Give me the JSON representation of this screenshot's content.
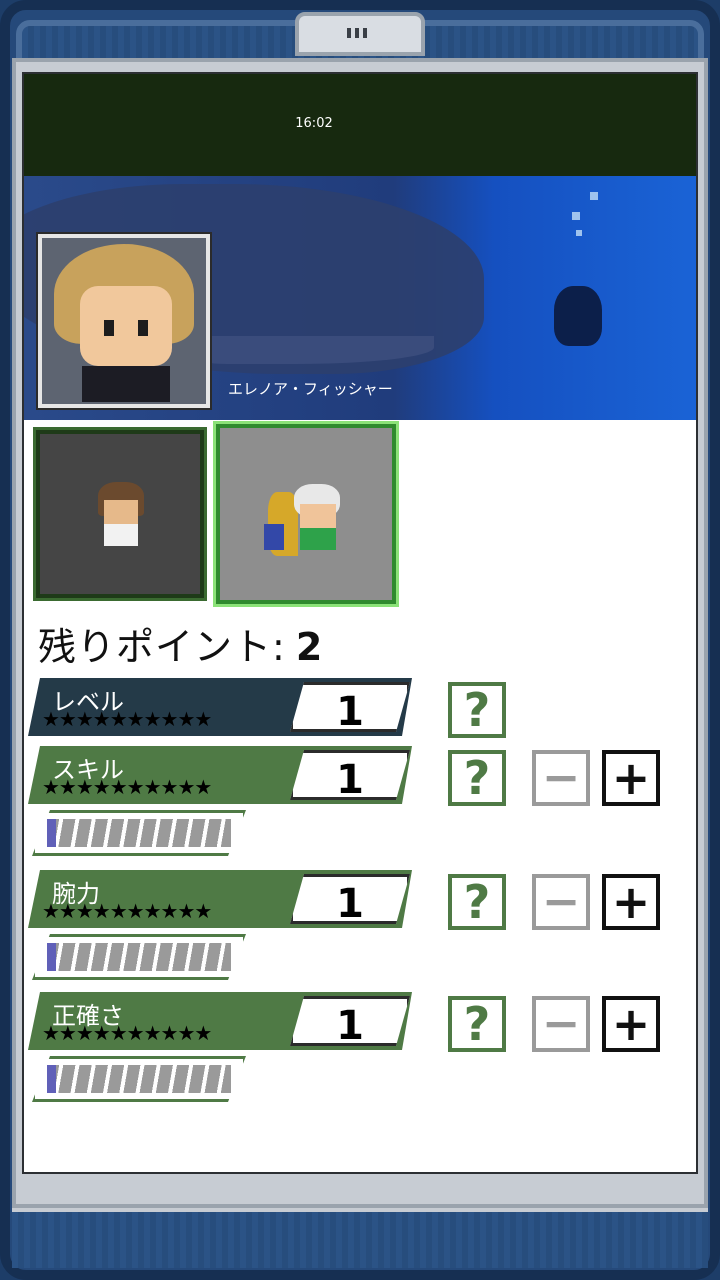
{
  "status_bar": {
    "time": "16:02"
  },
  "character": {
    "name": "エレノア・フィッシャー",
    "portrait_icon": "eleanor-portrait",
    "background_icon": "underwater-whale-scene"
  },
  "party": [
    {
      "icon": "bearded-man-sprite",
      "selected": false
    },
    {
      "icon": "diver-girl-sprite",
      "selected": true
    }
  ],
  "points": {
    "label": "残りポイント:",
    "value": "2"
  },
  "stars": "★★★★★★★★★★",
  "buttons": {
    "help": "?",
    "minus": "−",
    "plus": "+"
  },
  "stats": [
    {
      "label": "レベル",
      "value": "1",
      "adjustable": false
    },
    {
      "label": "スキル",
      "value": "1",
      "adjustable": true,
      "progress": 0.05
    },
    {
      "label": "腕力",
      "value": "1",
      "adjustable": true,
      "progress": 0.05
    },
    {
      "label": "正確さ",
      "value": "1",
      "adjustable": true,
      "progress": 0.05
    }
  ],
  "colors": {
    "accent_green": "#4f7a45",
    "level_band": "#243a48",
    "selected_outline": "#8be278",
    "progress_fill": "#6060b8"
  }
}
